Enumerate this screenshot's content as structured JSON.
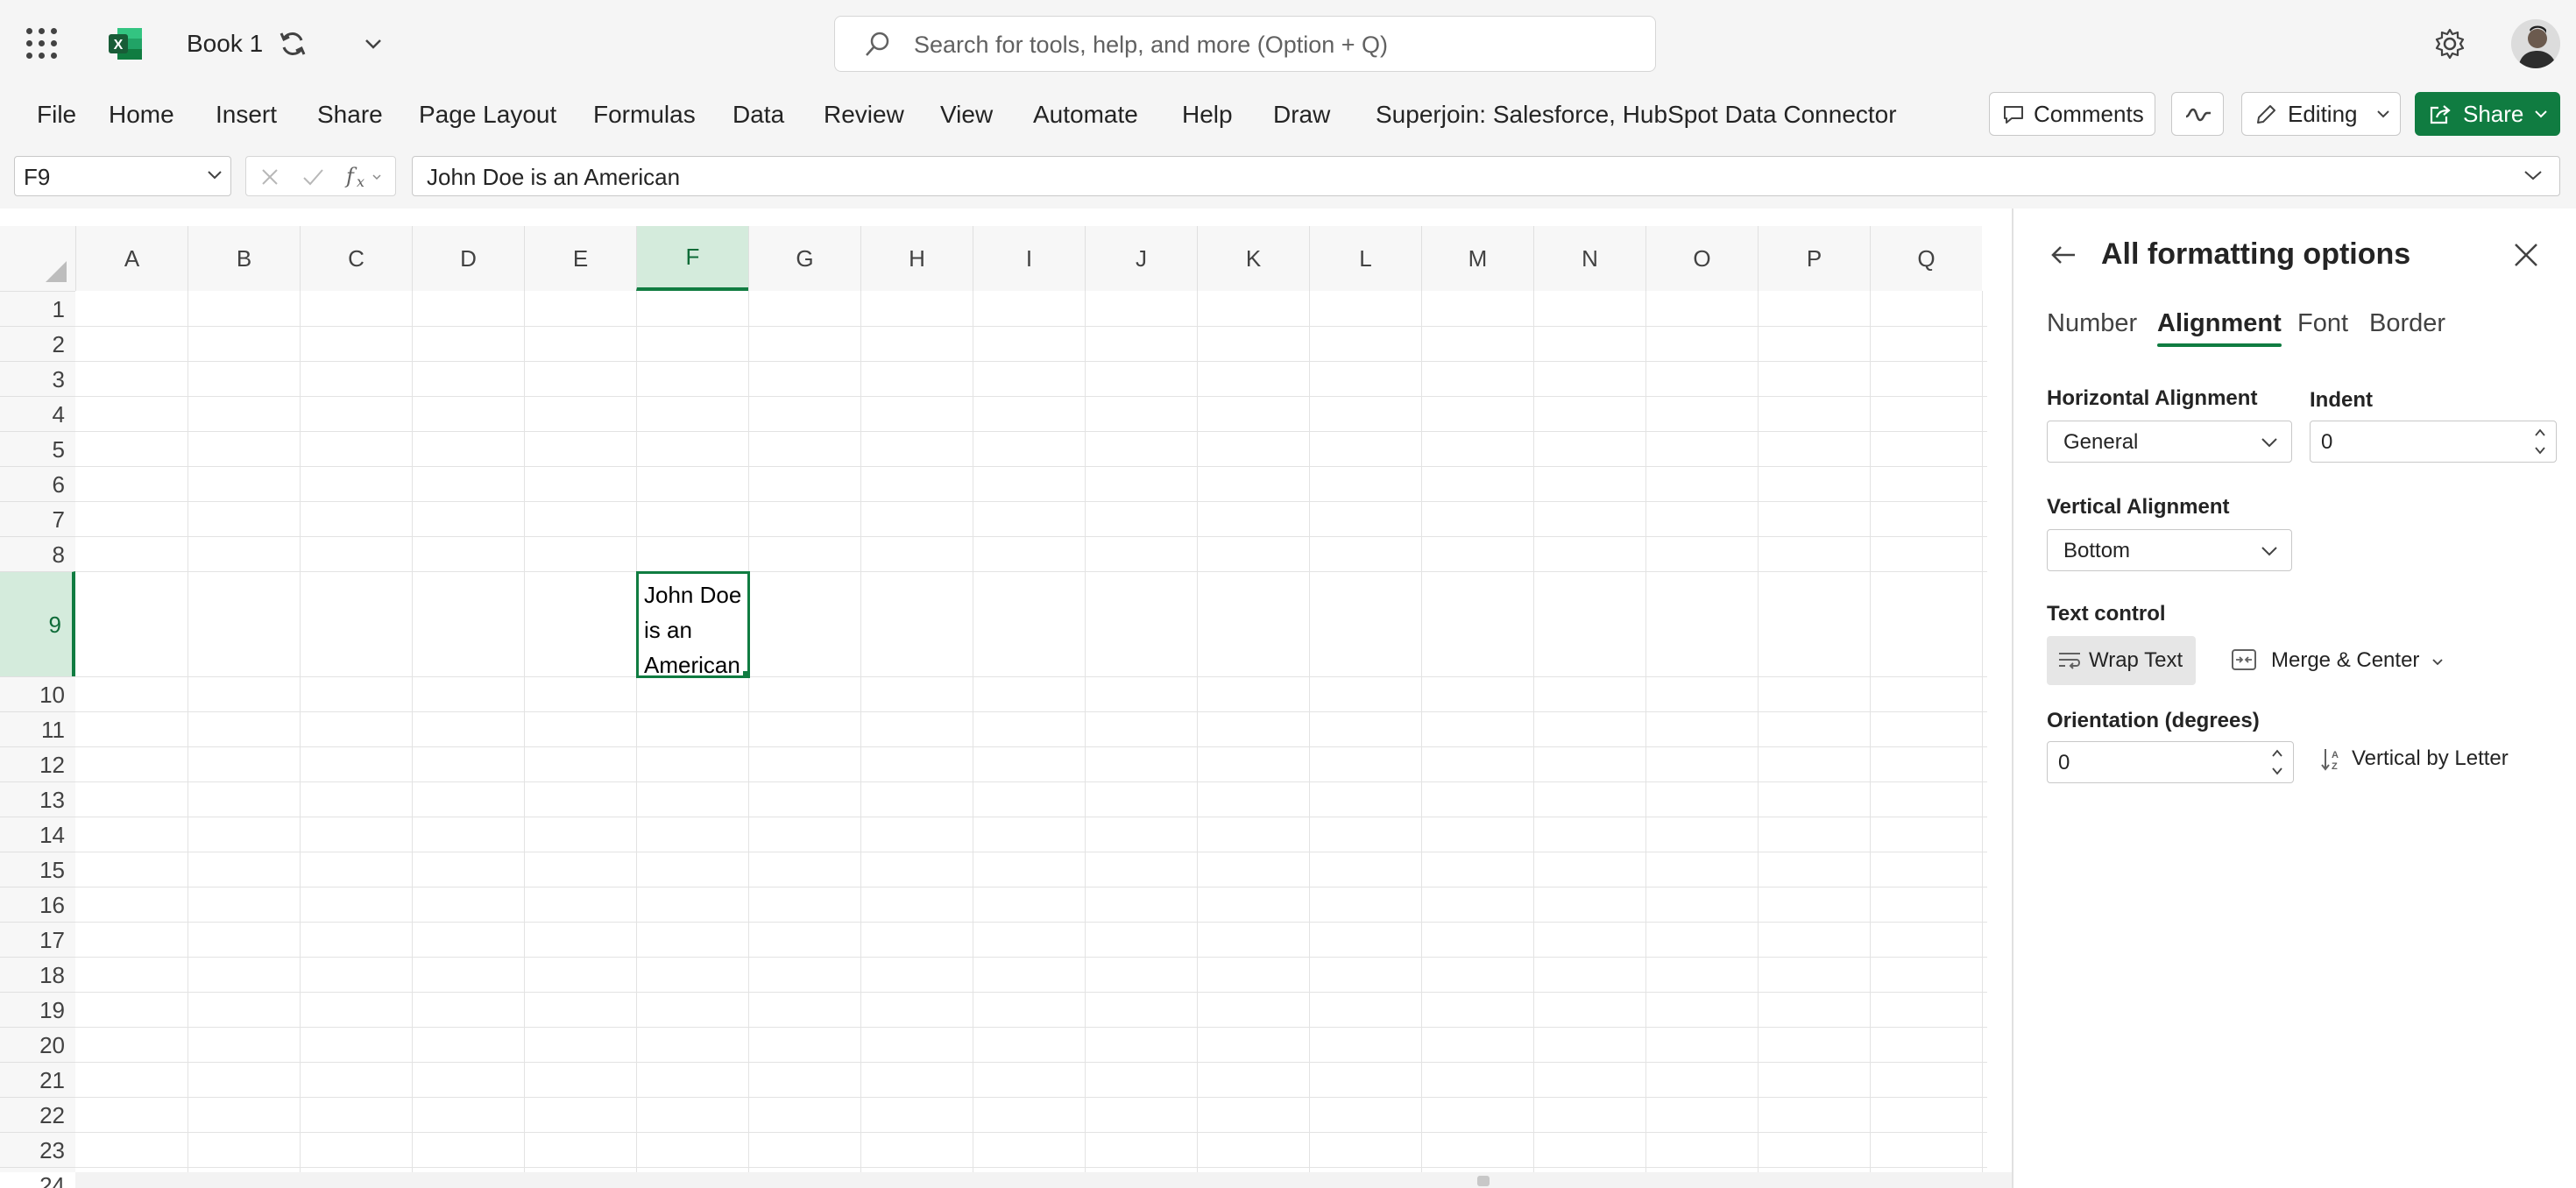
{
  "app": {
    "workbook_title": "Book 1",
    "search_placeholder": "Search for tools, help, and more (Option + Q)"
  },
  "ribbon": {
    "menu": [
      "File",
      "Home",
      "Insert",
      "Share",
      "Page Layout",
      "Formulas",
      "Data",
      "Review",
      "View",
      "Automate",
      "Help",
      "Draw",
      "Superjoin: Salesforce, HubSpot Data Connector"
    ],
    "comments_label": "Comments",
    "editing_label": "Editing",
    "share_label": "Share"
  },
  "formula_bar": {
    "name_box": "F9",
    "formula": "John Doe is an American"
  },
  "grid": {
    "columns": [
      "A",
      "B",
      "C",
      "D",
      "E",
      "F",
      "G",
      "H",
      "I",
      "J",
      "K",
      "L",
      "M",
      "N",
      "O",
      "P",
      "Q"
    ],
    "rows": [
      "1",
      "2",
      "3",
      "4",
      "5",
      "6",
      "7",
      "8",
      "9",
      "10",
      "11",
      "12",
      "13",
      "14",
      "15",
      "16",
      "17",
      "18",
      "19",
      "20",
      "21",
      "22",
      "23",
      "24"
    ],
    "selected_column": "F",
    "selected_row": "9",
    "active_cell_value": "John Doe is an American"
  },
  "pane": {
    "title": "All formatting options",
    "tabs": [
      "Number",
      "Alignment",
      "Font",
      "Border"
    ],
    "active_tab": "Alignment",
    "horizontal_alignment_label": "Horizontal Alignment",
    "horizontal_alignment_value": "General",
    "indent_label": "Indent",
    "indent_value": "0",
    "vertical_alignment_label": "Vertical Alignment",
    "vertical_alignment_value": "Bottom",
    "text_control_label": "Text control",
    "wrap_text_label": "Wrap Text",
    "merge_center_label": "Merge & Center",
    "orientation_label": "Orientation (degrees)",
    "orientation_value": "0",
    "vertical_by_letter_label": "Vertical by Letter"
  },
  "colors": {
    "accent": "#107c41",
    "selection_header": "#d4ebdc"
  }
}
